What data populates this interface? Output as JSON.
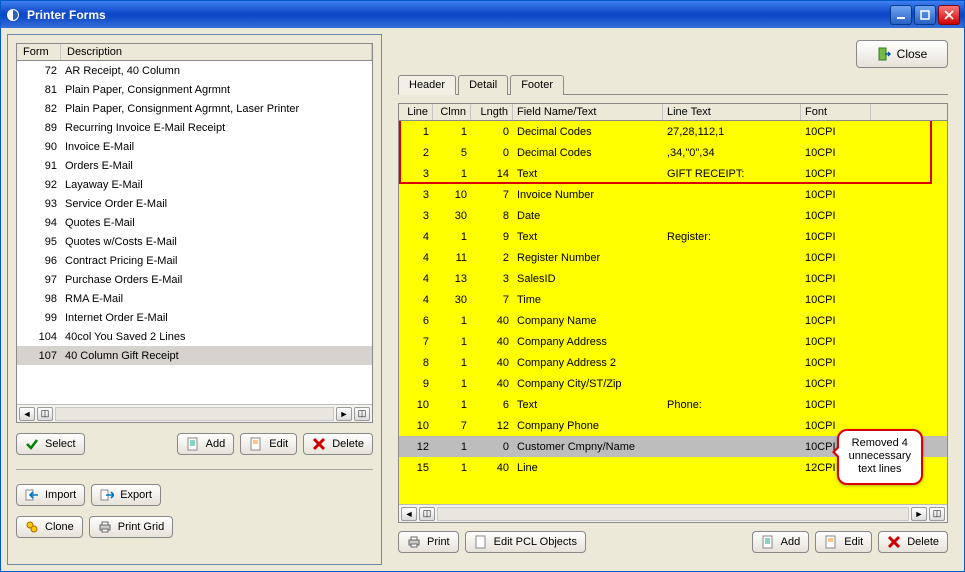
{
  "window": {
    "title": "Printer Forms"
  },
  "buttons": {
    "close": "Close",
    "select": "Select",
    "add": "Add",
    "edit": "Edit",
    "delete": "Delete",
    "import": "Import",
    "export": "Export",
    "clone": "Clone",
    "printgrid": "Print Grid",
    "print": "Print",
    "editpcl": "Edit PCL Objects"
  },
  "form_list": {
    "headers": {
      "form": "Form",
      "desc": "Description"
    },
    "rows": [
      {
        "form": "72",
        "desc": "AR Receipt, 40 Column"
      },
      {
        "form": "81",
        "desc": "Plain Paper, Consignment Agrmnt"
      },
      {
        "form": "82",
        "desc": "Plain Paper, Consignment Agrmnt, Laser Printer"
      },
      {
        "form": "89",
        "desc": "Recurring Invoice E-Mail Receipt"
      },
      {
        "form": "90",
        "desc": "Invoice E-Mail"
      },
      {
        "form": "91",
        "desc": "Orders E-Mail"
      },
      {
        "form": "92",
        "desc": "Layaway E-Mail"
      },
      {
        "form": "93",
        "desc": "Service Order E-Mail"
      },
      {
        "form": "94",
        "desc": "Quotes E-Mail"
      },
      {
        "form": "95",
        "desc": "Quotes w/Costs E-Mail"
      },
      {
        "form": "96",
        "desc": "Contract Pricing E-Mail"
      },
      {
        "form": "97",
        "desc": "Purchase Orders E-Mail"
      },
      {
        "form": "98",
        "desc": "RMA E-Mail"
      },
      {
        "form": "99",
        "desc": "Internet Order E-Mail"
      },
      {
        "form": "104",
        "desc": "40col You Saved 2 Lines"
      },
      {
        "form": "107",
        "desc": "40 Column Gift Receipt"
      }
    ],
    "selected_index": 15
  },
  "tabs": {
    "items": [
      "Header",
      "Detail",
      "Footer"
    ],
    "active": 0
  },
  "grid": {
    "headers": {
      "line": "Line",
      "clmn": "Clmn",
      "lngth": "Lngth",
      "field": "Field Name/Text",
      "ltext": "Line Text",
      "font": "Font"
    },
    "rows": [
      {
        "line": "1",
        "clmn": "1",
        "lngth": "0",
        "field": "Decimal Codes",
        "ltext": "27,28,112,1",
        "font": "10CPI"
      },
      {
        "line": "2",
        "clmn": "5",
        "lngth": "0",
        "field": "Decimal Codes",
        "ltext": ",34,\"0\",34",
        "font": "10CPI"
      },
      {
        "line": "3",
        "clmn": "1",
        "lngth": "14",
        "field": "Text",
        "ltext": "GIFT RECEIPT:",
        "font": "10CPI"
      },
      {
        "line": "3",
        "clmn": "10",
        "lngth": "7",
        "field": "Invoice Number",
        "ltext": "",
        "font": "10CPI"
      },
      {
        "line": "3",
        "clmn": "30",
        "lngth": "8",
        "field": "Date",
        "ltext": "",
        "font": "10CPI"
      },
      {
        "line": "4",
        "clmn": "1",
        "lngth": "9",
        "field": "Text",
        "ltext": "Register:",
        "font": "10CPI"
      },
      {
        "line": "4",
        "clmn": "11",
        "lngth": "2",
        "field": "Register Number",
        "ltext": "",
        "font": "10CPI"
      },
      {
        "line": "4",
        "clmn": "13",
        "lngth": "3",
        "field": "SalesID",
        "ltext": "",
        "font": "10CPI"
      },
      {
        "line": "4",
        "clmn": "30",
        "lngth": "7",
        "field": "Time",
        "ltext": "",
        "font": "10CPI"
      },
      {
        "line": "6",
        "clmn": "1",
        "lngth": "40",
        "field": "Company Name",
        "ltext": "",
        "font": "10CPI"
      },
      {
        "line": "7",
        "clmn": "1",
        "lngth": "40",
        "field": "Company Address",
        "ltext": "",
        "font": "10CPI"
      },
      {
        "line": "8",
        "clmn": "1",
        "lngth": "40",
        "field": "Company Address 2",
        "ltext": "",
        "font": "10CPI"
      },
      {
        "line": "9",
        "clmn": "1",
        "lngth": "40",
        "field": "Company City/ST/Zip",
        "ltext": "",
        "font": "10CPI"
      },
      {
        "line": "10",
        "clmn": "1",
        "lngth": "6",
        "field": "Text",
        "ltext": "Phone:",
        "font": "10CPI"
      },
      {
        "line": "10",
        "clmn": "7",
        "lngth": "12",
        "field": "Company Phone",
        "ltext": "",
        "font": "10CPI"
      },
      {
        "line": "12",
        "clmn": "1",
        "lngth": "0",
        "field": "Customer Cmpny/Name",
        "ltext": "",
        "font": "10CPI"
      },
      {
        "line": "15",
        "clmn": "1",
        "lngth": "40",
        "field": "Line",
        "ltext": "",
        "font": "12CPI"
      }
    ],
    "selected_index": 15
  },
  "annotations": {
    "callout": "Removed 4\nunnecessary\ntext lines"
  }
}
